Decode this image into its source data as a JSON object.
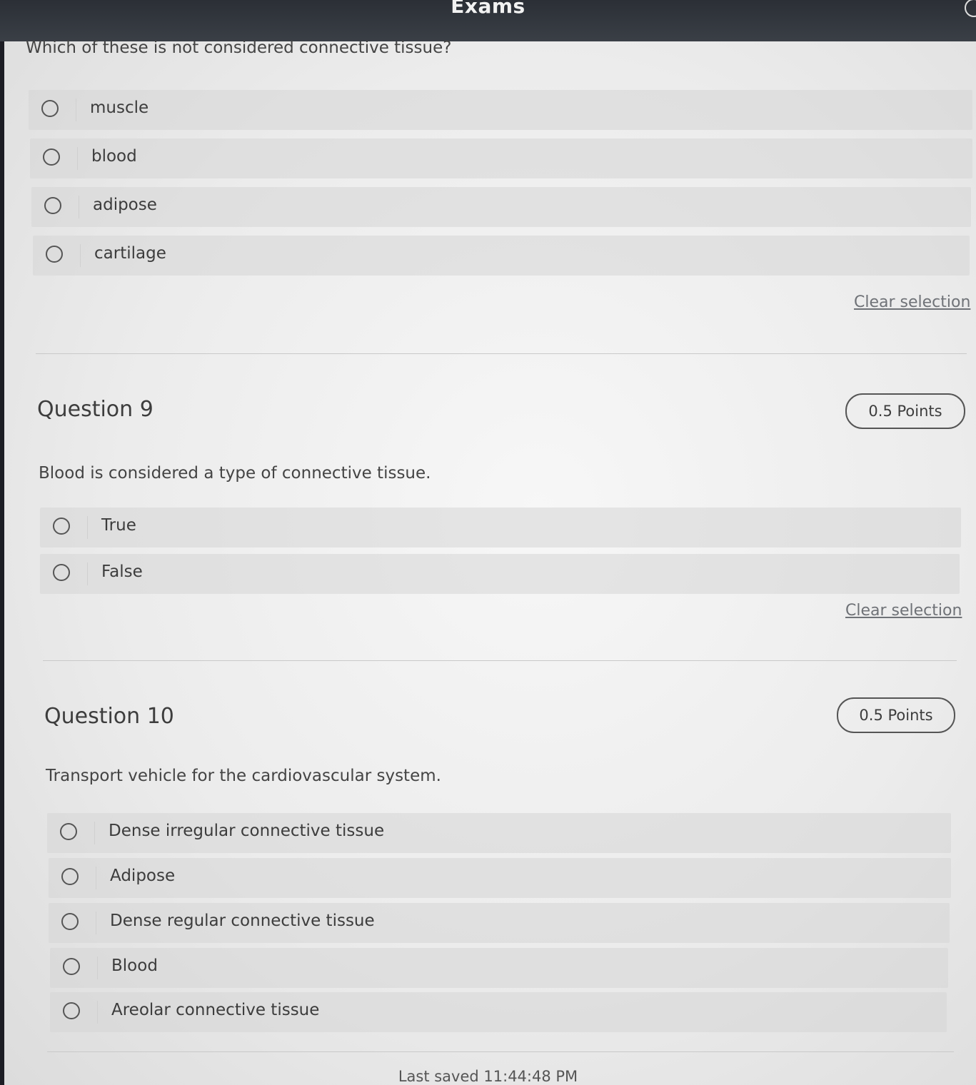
{
  "app": {
    "title": "Exams"
  },
  "question8": {
    "stem": "Which of these is not considered connective tissue?",
    "options": [
      "muscle",
      "blood",
      "adipose",
      "cartilage"
    ],
    "clear_label": "Clear selection"
  },
  "question9": {
    "title": "Question 9",
    "points": "0.5 Points",
    "stem": "Blood is considered a type of connective tissue.",
    "options": [
      "True",
      "False"
    ],
    "clear_label": "Clear selection"
  },
  "question10": {
    "title": "Question 10",
    "points": "0.5 Points",
    "stem": "Transport vehicle for the cardiovascular system.",
    "options": [
      "Dense irregular connective tissue",
      "Adipose",
      "Dense regular connective tissue",
      "Blood",
      "Areolar connective tissue"
    ]
  },
  "footer": {
    "last_saved": "Last saved 11:44:48 PM"
  }
}
